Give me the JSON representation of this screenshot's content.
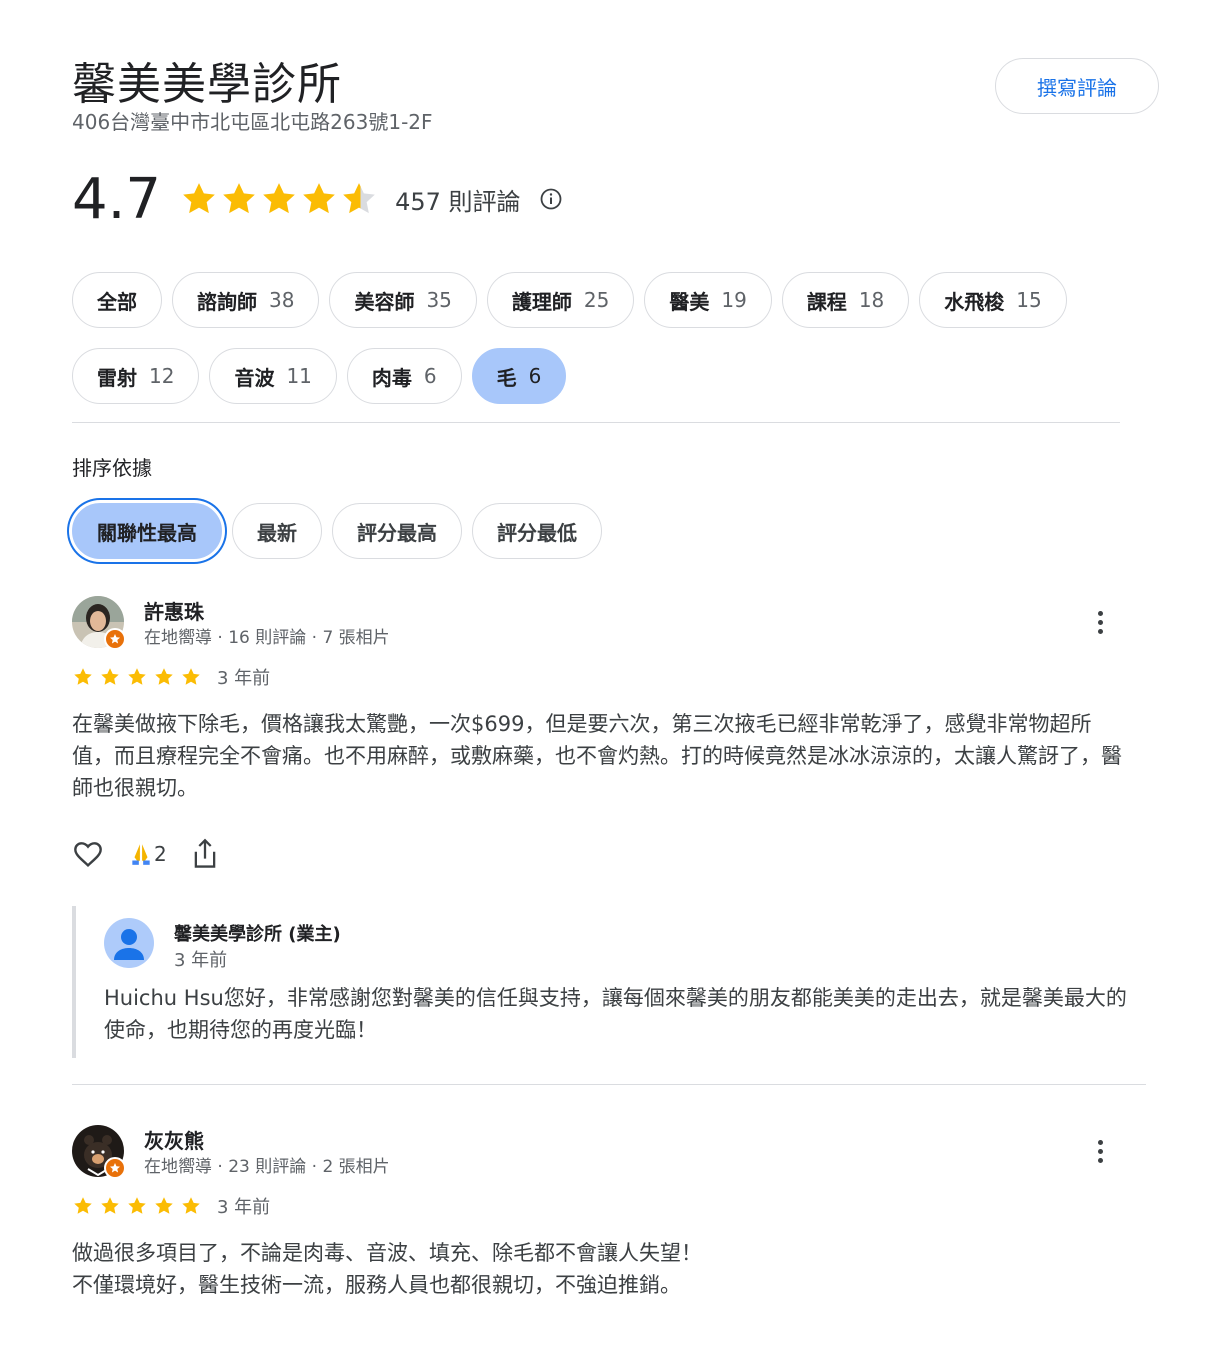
{
  "place": {
    "name": "馨美美學診所",
    "address": "406台灣臺中市北屯區北屯路263號1-2F",
    "write_review_label": "撰寫評論"
  },
  "rating": {
    "value": "4.7",
    "stars": 4.7,
    "count_label": "457 則評論"
  },
  "topics": [
    {
      "label": "全部",
      "count": ""
    },
    {
      "label": "諮詢師",
      "count": "38"
    },
    {
      "label": "美容師",
      "count": "35"
    },
    {
      "label": "護理師",
      "count": "25"
    },
    {
      "label": "醫美",
      "count": "19"
    },
    {
      "label": "課程",
      "count": "18"
    },
    {
      "label": "水飛梭",
      "count": "15"
    },
    {
      "label": "雷射",
      "count": "12"
    },
    {
      "label": "音波",
      "count": "11"
    },
    {
      "label": "肉毒",
      "count": "6"
    },
    {
      "label": "毛",
      "count": "6"
    }
  ],
  "sort": {
    "label": "排序依據",
    "options": [
      "關聯性最高",
      "最新",
      "評分最高",
      "評分最低"
    ]
  },
  "reviews": [
    {
      "name": "許惠珠",
      "meta": "在地嚮導 · 16 則評論 · 7 張相片",
      "time": "3 年前",
      "stars": 5,
      "text": "在馨美做掖下除毛，價格讓我太驚艷，一次$699，但是要六次，第三次掖毛已經非常乾淨了，感覺非常物超所值，而且療程完全不會痛。也不用麻醉，或敷麻藥，也不會灼熱。打的時候竟然是冰冰涼涼的，太讓人驚訝了，醫師也很親切。",
      "pray_count": "2",
      "owner_reply": {
        "name": "馨美美學診所 (業主)",
        "time": "3 年前",
        "text": "Huichu Hsu您好，非常感謝您對馨美的信任與支持，讓每個來馨美的朋友都能美美的走出去，就是馨美最大的使命，也期待您的再度光臨！"
      }
    },
    {
      "name": "灰灰熊",
      "meta": "在地嚮導 · 23 則評論 · 2 張相片",
      "time": "3 年前",
      "stars": 5,
      "text": "做過很多項目了，不論是肉毒、音波、填充、除毛都不會讓人失望！\n不僅環境好，醫生技術一流，服務人員也都很親切，不強迫推銷。"
    }
  ],
  "colors": {
    "star": "#fbbc04",
    "star_empty": "#dadce0",
    "accent": "#1a73e8",
    "active_chip": "#a8c7fa",
    "guide_badge": "#e8710a"
  }
}
